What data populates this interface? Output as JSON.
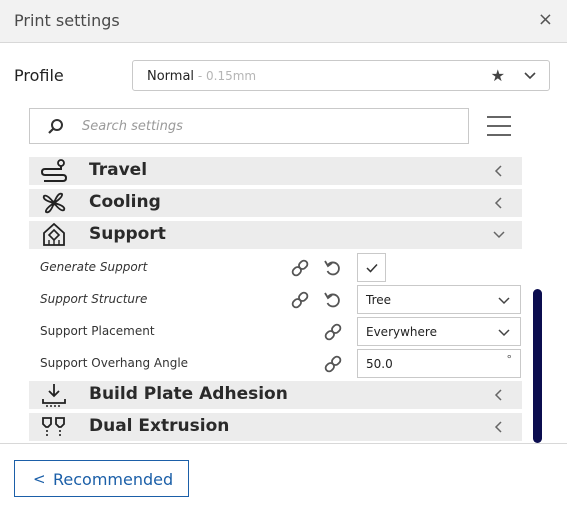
{
  "window": {
    "title": "Print settings",
    "close_icon": "×"
  },
  "profile": {
    "label": "Profile",
    "name": "Normal",
    "detail": " - 0.15mm"
  },
  "search": {
    "placeholder": "Search settings"
  },
  "categories": [
    {
      "label": "Travel",
      "icon": "travel-icon",
      "state": "collapsed"
    },
    {
      "label": "Cooling",
      "icon": "fan-icon",
      "state": "collapsed"
    },
    {
      "label": "Support",
      "icon": "support-icon",
      "state": "expanded"
    },
    {
      "label": "Build Plate Adhesion",
      "icon": "adhesion-icon",
      "state": "collapsed"
    },
    {
      "label": "Dual Extrusion",
      "icon": "dual-extrusion-icon",
      "state": "collapsed"
    }
  ],
  "support_settings": [
    {
      "label": "Generate Support",
      "type": "checkbox",
      "checked": true
    },
    {
      "label": "Support Structure",
      "type": "dropdown",
      "value": "Tree"
    },
    {
      "label": "Support Placement",
      "type": "dropdown",
      "value": "Everywhere"
    },
    {
      "label": "Support Overhang Angle",
      "type": "number",
      "value": "50.0",
      "unit": "°"
    }
  ],
  "footer": {
    "recommended_label": "Recommended"
  },
  "colors": {
    "accent": "#1b5fa8",
    "scrollbar": "#0b0d4f",
    "category_bg": "#ececec"
  }
}
